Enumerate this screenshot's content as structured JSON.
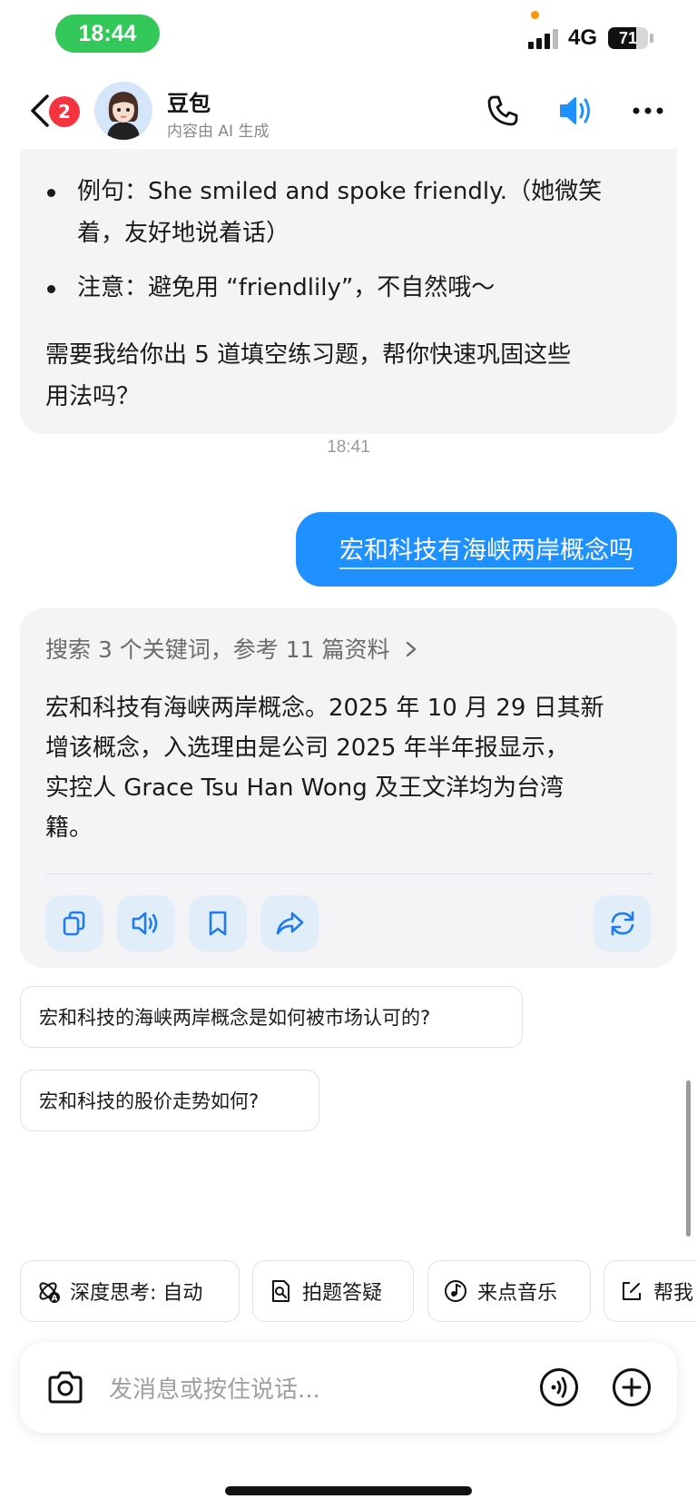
{
  "status_bar": {
    "time": "18:44",
    "network": "4G",
    "battery": "71",
    "battery_level": 0.71
  },
  "header": {
    "back_badge": "2",
    "bot_name": "豆包",
    "bot_subtitle": "内容由 AI 生成",
    "icons": [
      "back-icon",
      "phone-icon",
      "speaker-icon",
      "more-icon"
    ]
  },
  "messages": {
    "prev_ai": {
      "bullets": [
        "例句：She smiled and spoke friendly.（她微笑着，友好地说着话）",
        "注意：避免用 “friendlily”，不自然哦～"
      ],
      "bullet_lines": [
        [
          "例句：She smiled and spoke friendly.（她微笑",
          "着，友好地说着话）"
        ],
        [
          "注意：避免用 “friendlily”，不自然哦～"
        ]
      ],
      "closing_lines": [
        "需要我给你出 5 道填空练习题，帮你快速巩固这些",
        "用法吗？"
      ]
    },
    "timestamp": "18:41",
    "user_message": "宏和科技有海峡两岸概念吗",
    "ai_reply": {
      "search_summary": "搜索 3 个关键词，参考 11 篇资料",
      "lines": [
        "宏和科技有海峡两岸概念。2025 年 10 月 29 日其新",
        "增该概念，入选理由是公司 2025 年半年报显示，",
        "实控人 Grace Tsu Han Wong 及王文洋均为台湾",
        "籍。"
      ],
      "actions": [
        "copy-icon",
        "read-aloud-icon",
        "bookmark-icon",
        "share-icon",
        "regenerate-icon"
      ]
    }
  },
  "suggestions": [
    "宏和科技的海峡两岸概念是如何被市场认可的?",
    "宏和科技的股价走势如何?"
  ],
  "chips": [
    {
      "label": "深度思考: 自动",
      "icon": "deep-think-icon"
    },
    {
      "label": "拍题答疑",
      "icon": "photo-question-icon"
    },
    {
      "label": "来点音乐",
      "icon": "music-icon"
    },
    {
      "label": "帮我",
      "icon": "edit-icon"
    }
  ],
  "input": {
    "placeholder": "发消息或按住说话...",
    "icons": [
      "camera-icon",
      "voice-icon",
      "add-icon"
    ]
  },
  "colors": {
    "accent": "#1e90ff",
    "time_pill": "#34c759",
    "badge": "#f5333f",
    "card_bg": "#f4f4f6"
  }
}
